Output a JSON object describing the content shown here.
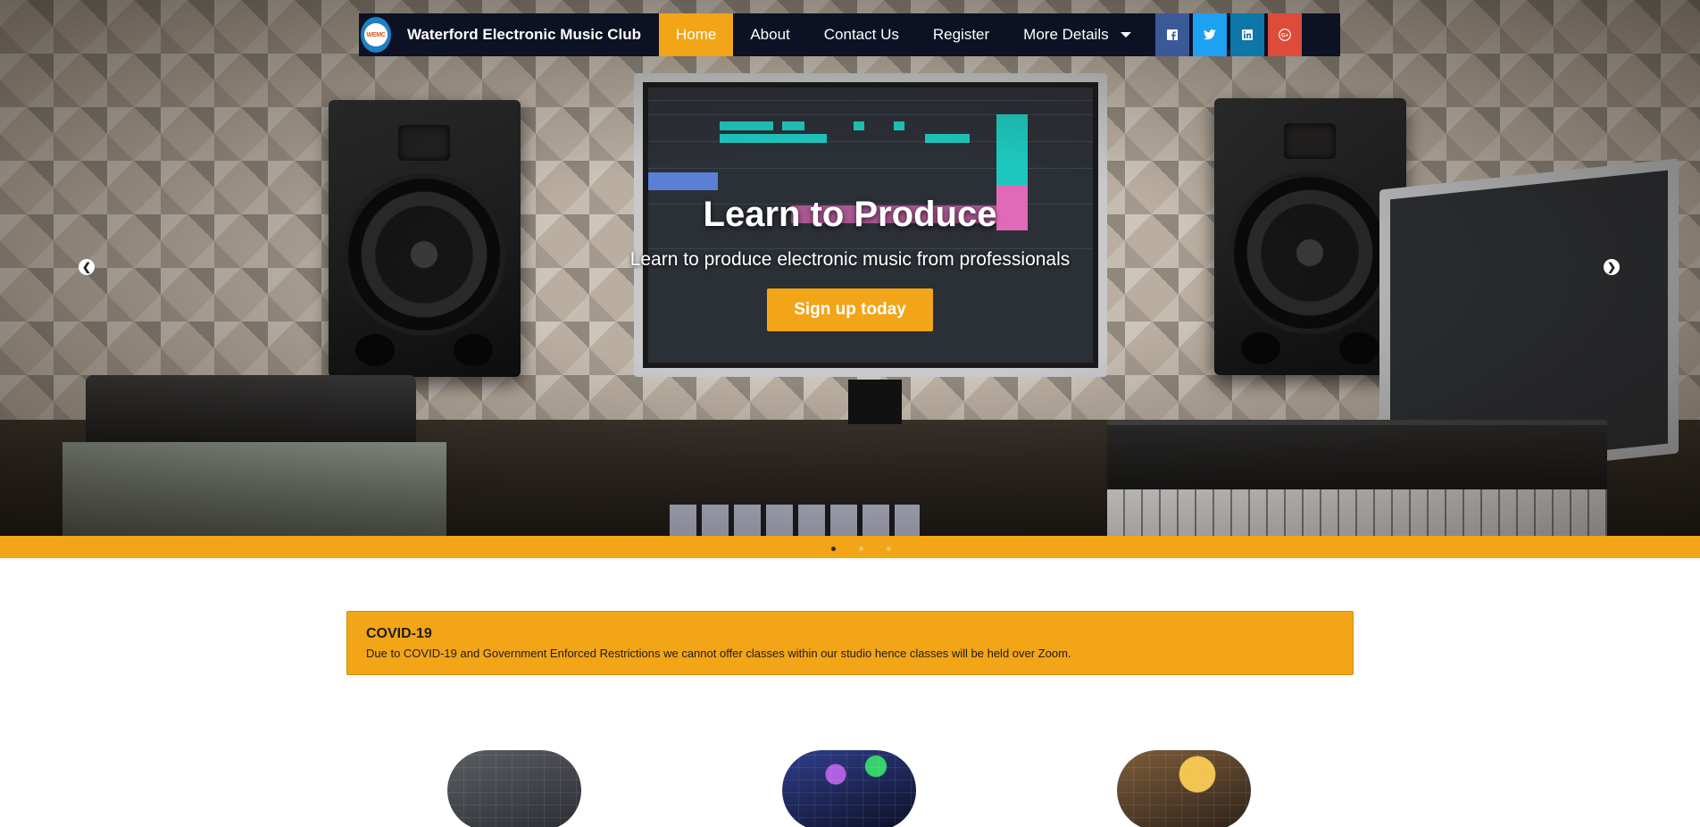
{
  "brand": {
    "name": "Waterford Electronic Music Club",
    "logo_text": "WEMC"
  },
  "nav": {
    "items": [
      {
        "label": "Home",
        "active": true
      },
      {
        "label": "About",
        "active": false
      },
      {
        "label": "Contact Us",
        "active": false
      },
      {
        "label": "Register",
        "active": false
      },
      {
        "label": "More Details",
        "active": false,
        "dropdown": true
      }
    ],
    "social": [
      {
        "name": "facebook-icon",
        "color": "#3b5998"
      },
      {
        "name": "twitter-icon",
        "color": "#1da1f2"
      },
      {
        "name": "linkedin-icon",
        "color": "#0e76a8"
      },
      {
        "name": "google-plus-icon",
        "color": "#dd4b39"
      }
    ]
  },
  "hero": {
    "title": "Learn to Produce",
    "subtitle": "Learn to produce electronic music from professionals",
    "cta": "Sign up today",
    "slides": 3,
    "active_slide": 1
  },
  "alert": {
    "title": "COVID-19",
    "body": "Due to COVID-19 and Government Enforced Restrictions we cannot offer classes within our studio hence classes will be held over Zoom."
  },
  "colors": {
    "accent": "#f2a516",
    "navbar": "#0c1124",
    "text": "#1d1d1d"
  }
}
